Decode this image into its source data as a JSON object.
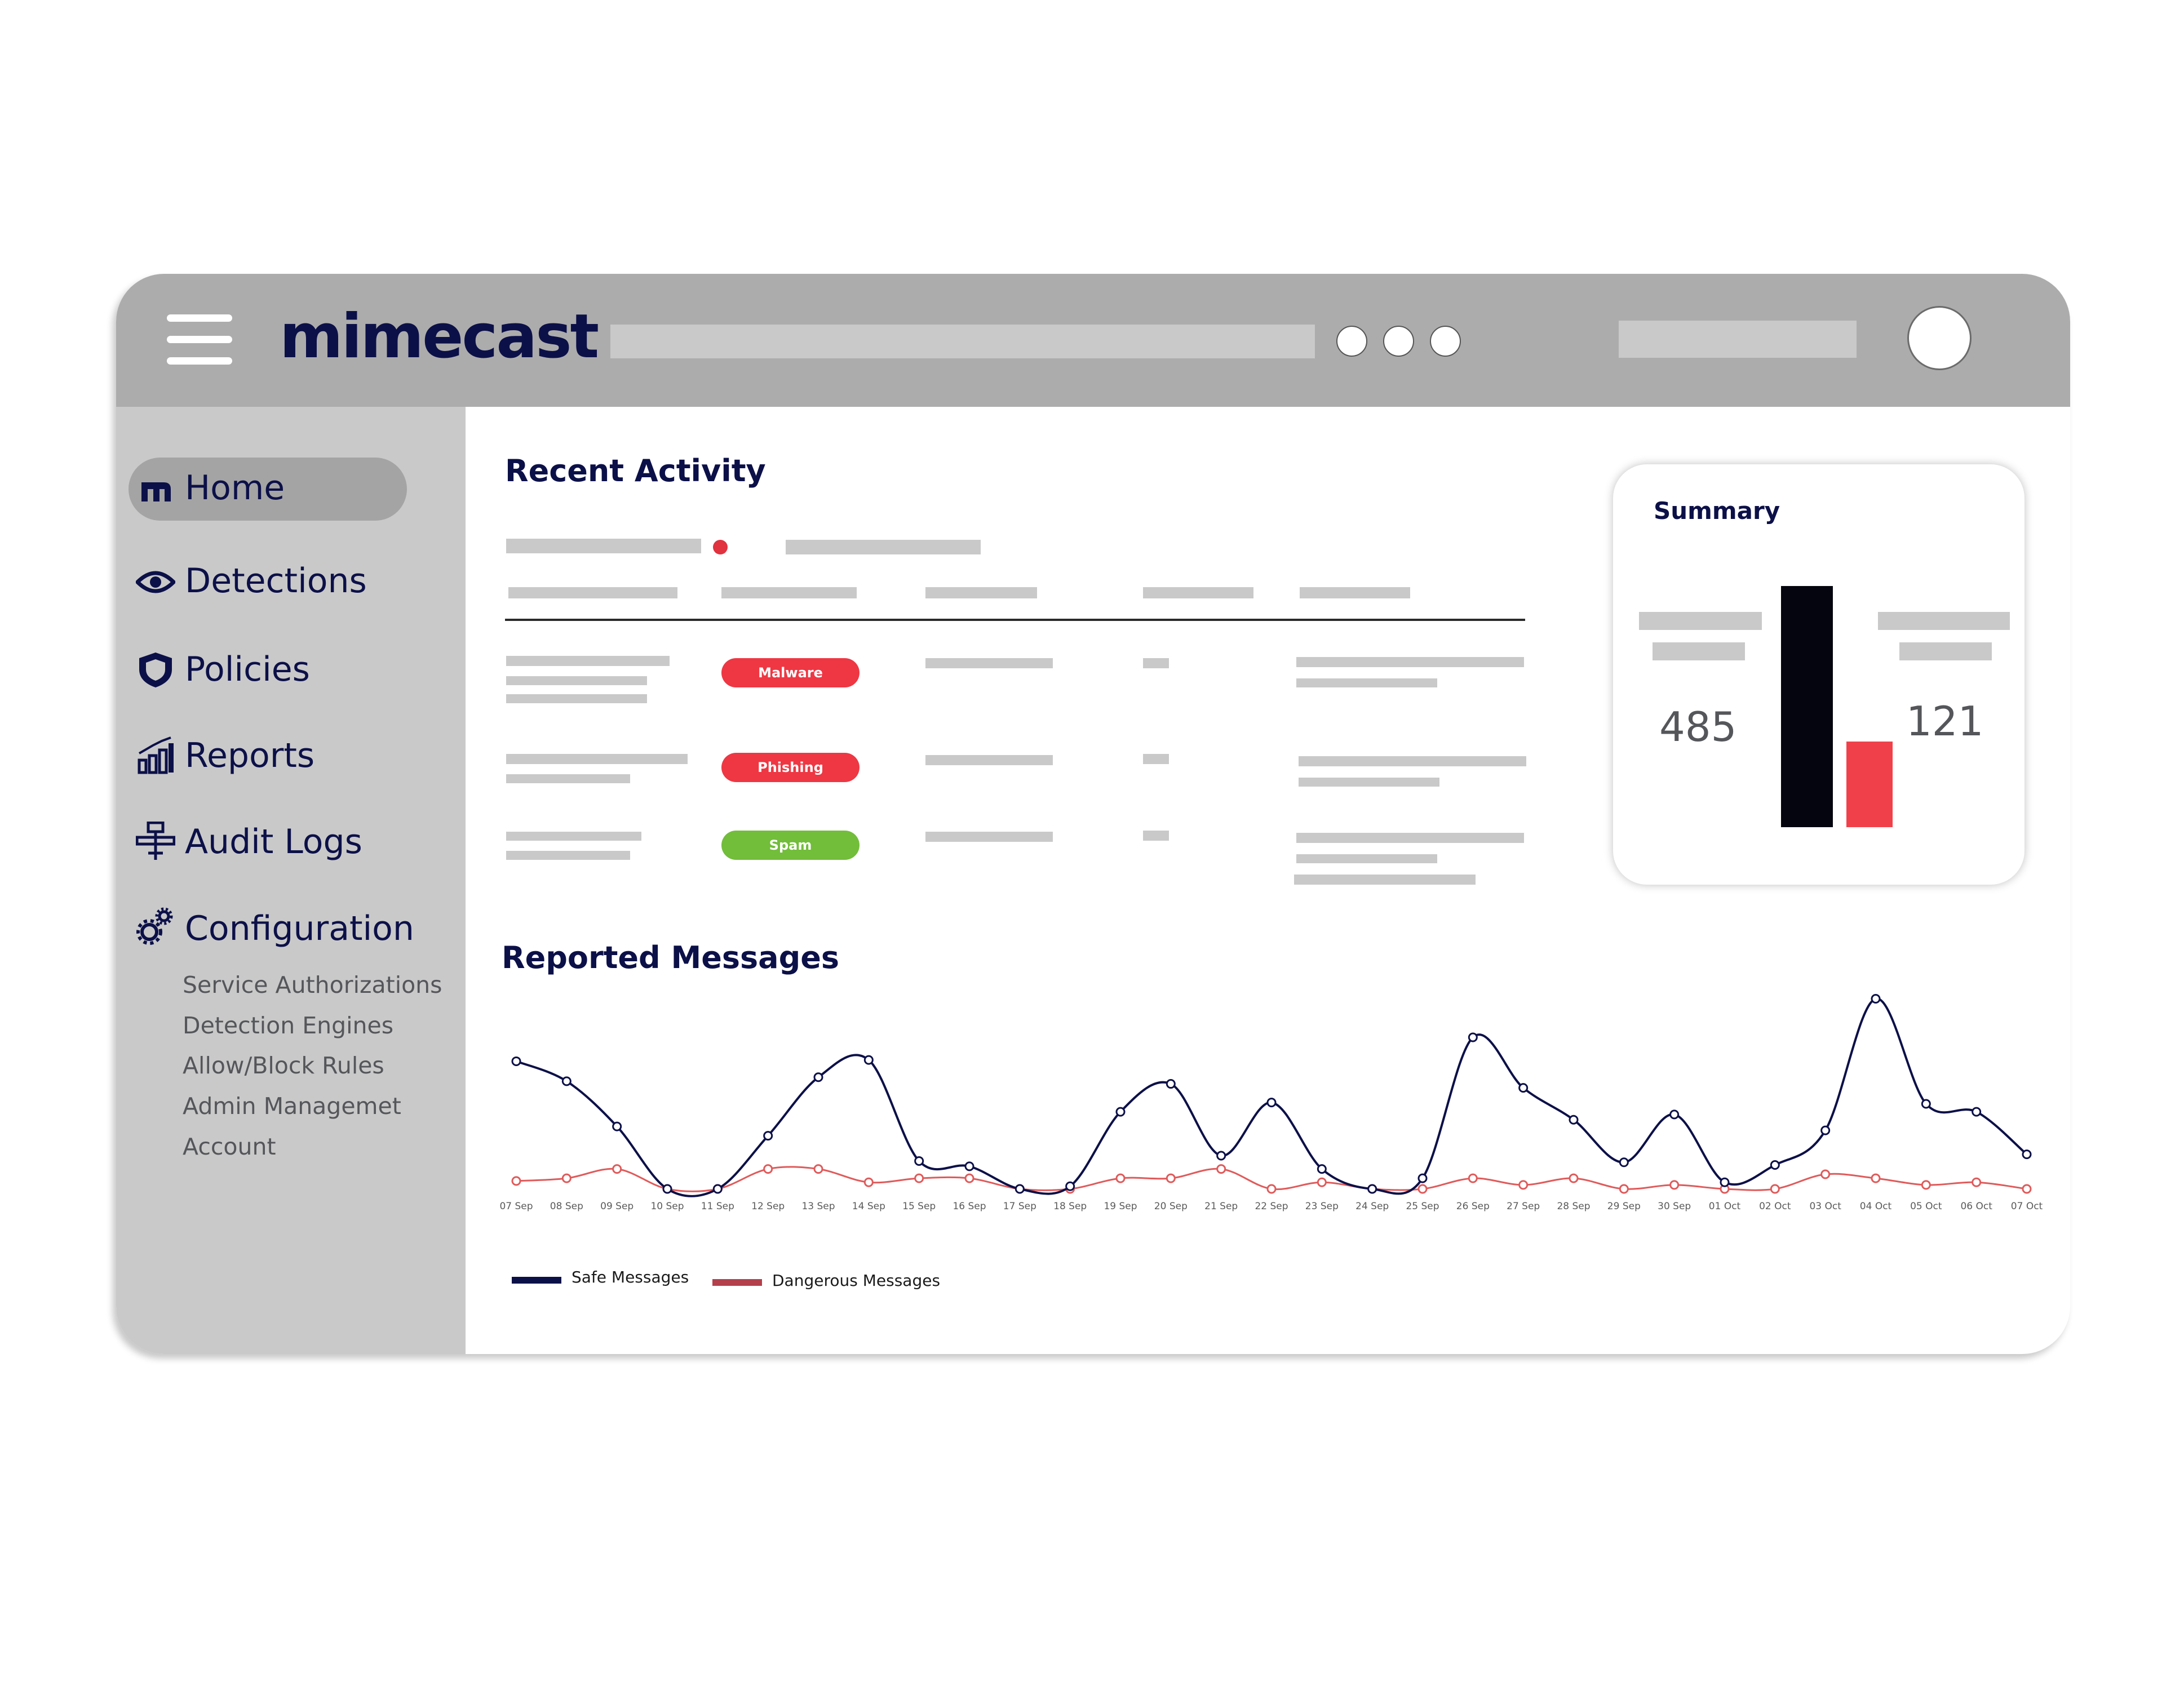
{
  "app": {
    "brand": "mimecast"
  },
  "sidebar": {
    "items": [
      {
        "label": "Home",
        "icon": "mimecast-m-icon"
      },
      {
        "label": "Detections",
        "icon": "eye-icon"
      },
      {
        "label": "Policies",
        "icon": "shield-icon"
      },
      {
        "label": "Reports",
        "icon": "bar-chart-icon"
      },
      {
        "label": "Audit Logs",
        "icon": "network-icon"
      },
      {
        "label": "Configuration",
        "icon": "gears-icon"
      }
    ],
    "config_items": [
      "Service Authorizations",
      "Detection Engines",
      "Allow/Block Rules",
      "Admin Managemet",
      "Account"
    ]
  },
  "recent_activity": {
    "title": "Recent Activity",
    "badges": [
      {
        "label": "Malware",
        "color": "#ee3743"
      },
      {
        "label": "Phishing",
        "color": "#ee3743"
      },
      {
        "label": "Spam",
        "color": "#72bd3a"
      }
    ]
  },
  "summary": {
    "title": "Summary",
    "left_value": "485",
    "right_value": "121",
    "bar_colors": [
      "#05050f",
      "#f0414a"
    ]
  },
  "reported_messages": {
    "title": "Reported Messages"
  },
  "colors": {
    "navy": "#0c1048",
    "safe_line": "#0c1048",
    "danger_line": "#e05a5a",
    "sidebar_bg": "#c9c9c9",
    "topbar_bg": "#acacac"
  },
  "chart_data": {
    "type": "line",
    "x": [
      "07 Sep",
      "08 Sep",
      "09 Sep",
      "10 Sep",
      "11 Sep",
      "12 Sep",
      "13 Sep",
      "14 Sep",
      "15 Sep",
      "16 Sep",
      "17 Sep",
      "18 Sep",
      "19 Sep",
      "20 Sep",
      "21 Sep",
      "22 Sep",
      "23 Sep",
      "24 Sep",
      "25 Sep",
      "26 Sep",
      "27 Sep",
      "28 Sep",
      "29 Sep",
      "30 Sep",
      "01 Oct",
      "02 Oct",
      "03 Oct",
      "04 Oct",
      "05 Oct",
      "06 Oct",
      "07 Oct"
    ],
    "series": [
      {
        "name": "Safe Messages",
        "values": [
          96,
          81,
          47,
          0,
          0,
          40,
          84,
          97,
          21,
          17,
          0,
          2,
          58,
          79,
          25,
          65,
          15,
          0,
          8,
          114,
          76,
          52,
          20,
          56,
          5,
          18,
          44,
          143,
          64,
          58,
          26
        ]
      },
      {
        "name": "Dangerous Messages",
        "values": [
          6,
          8,
          15,
          0,
          0,
          15,
          15,
          5,
          8,
          8,
          0,
          0,
          8,
          8,
          15,
          0,
          5,
          0,
          0,
          8,
          3,
          8,
          0,
          3,
          0,
          0,
          11,
          8,
          3,
          5,
          0
        ]
      }
    ],
    "ylim": [
      0,
      150
    ],
    "legend": "bottom-left",
    "grid": false,
    "title": "",
    "xlabel": "",
    "ylabel": ""
  }
}
